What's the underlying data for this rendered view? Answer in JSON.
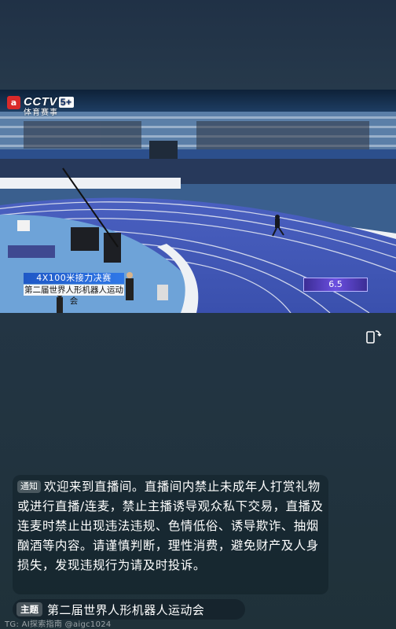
{
  "video": {
    "channel_logo_text": "CCTV",
    "channel_number": "5+",
    "channel_subtitle": "体育赛事",
    "caption_event": "4X100米接力决赛",
    "caption_meet": "第二届世界人形机器人运动会",
    "speed_value": "6.5"
  },
  "controls": {
    "rotate_icon": "screen-rotate-icon"
  },
  "notice": {
    "tag": "通知",
    "text": "欢迎来到直播间。直播间内禁止未成年人打赏礼物或进行直播/连麦，禁止主播诱导观众私下交易，直播及连麦时禁止出现违法违规、色情低俗、诱导欺诈、抽烟酗酒等内容。请谨慎判断，理性消费，避免财产及人身损失，发现违规行为请及时投诉。"
  },
  "topic": {
    "tag": "主题",
    "text": "第二届世界人形机器人运动会"
  },
  "watermark": "TG: AI探索指南 @aigc1024",
  "colors": {
    "track_blue": "#3f57b5",
    "caption_blue": "#1f58c6",
    "speed_purple": "#6b4fe0",
    "background": "#233544"
  }
}
